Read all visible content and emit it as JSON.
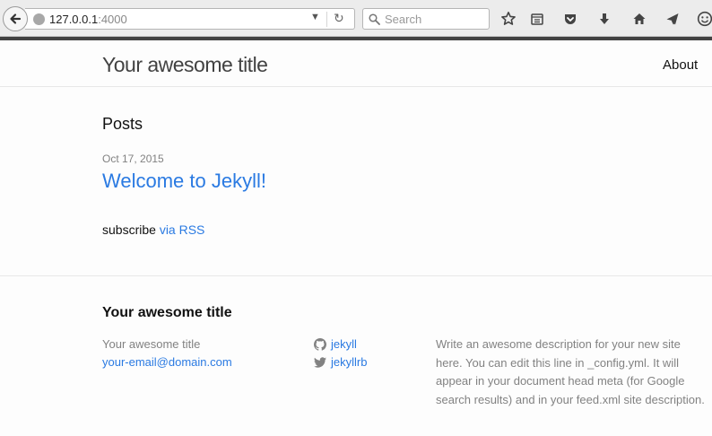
{
  "browser": {
    "url_host": "127.0.0.1",
    "url_port": ":4000",
    "search_placeholder": "Search"
  },
  "header": {
    "site_title": "Your awesome title",
    "nav": {
      "about": "About"
    }
  },
  "main": {
    "posts_heading": "Posts",
    "posts": [
      {
        "date": "Oct 17, 2015",
        "title": "Welcome to Jekyll!"
      }
    ],
    "subscribe_text": "subscribe",
    "rss_link": "via RSS"
  },
  "footer": {
    "heading": "Your awesome title",
    "name": "Your awesome title",
    "email": "your-email@domain.com",
    "github": "jekyll",
    "twitter": "jekyllrb",
    "description": "Write an awesome description for your new site here. You can edit this line in _config.yml. It will appear in your document head meta (for Google search results) and in your feed.xml site description."
  },
  "colors": {
    "link": "#2a7ae2",
    "muted": "#828282",
    "chrome_bg": "#ececec",
    "accent_bar": "#424242"
  }
}
